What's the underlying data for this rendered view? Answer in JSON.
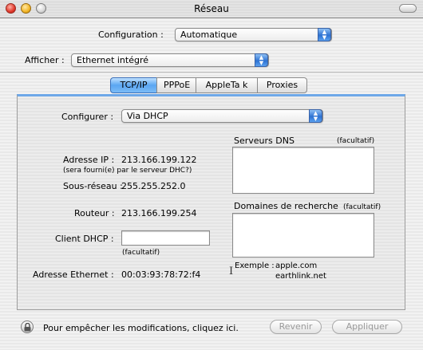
{
  "window": {
    "title": "Réseau"
  },
  "configuration": {
    "label": "Configuration :",
    "value": "Automatique"
  },
  "afficher": {
    "label": "Afficher :",
    "value": "Ethernet intégré"
  },
  "tabs": [
    {
      "label": "TCP/IP",
      "selected": true
    },
    {
      "label": "PPPoE",
      "selected": false
    },
    {
      "label": "AppleTa k",
      "selected": false
    },
    {
      "label": "Proxies",
      "selected": false
    }
  ],
  "tcpip": {
    "configurer": {
      "label": "Configurer :",
      "value": "Via DHCP"
    },
    "ip": {
      "label": "Adresse IP :",
      "value": "213.166.199.122",
      "note": "(sera fourni(e) par le serveur DHC?)"
    },
    "subnet": {
      "label": "Sous-réseau :",
      "value": "255.255.252.0"
    },
    "router": {
      "label": "Routeur :",
      "value": "213.166.199.254"
    },
    "dhcp_client": {
      "label": "Client DHCP :",
      "value": "",
      "note": "(facultatif)"
    },
    "ethernet": {
      "label": "Adresse Ethernet :",
      "value": "00:03:93:78:72:f4"
    },
    "dns": {
      "label": "Serveurs DNS",
      "optional": "(facultatif)",
      "value": ""
    },
    "search_domains": {
      "label": "Domaines de recherche",
      "optional": "(facultatif)",
      "value": ""
    },
    "example": {
      "label": "Exemple :",
      "line1": "apple.com",
      "line2": "earthlink.net"
    }
  },
  "footer": {
    "lock_text": "Pour empêcher les modifications, cliquez ici.",
    "revert": "Revenir",
    "apply": "Appliquer"
  }
}
